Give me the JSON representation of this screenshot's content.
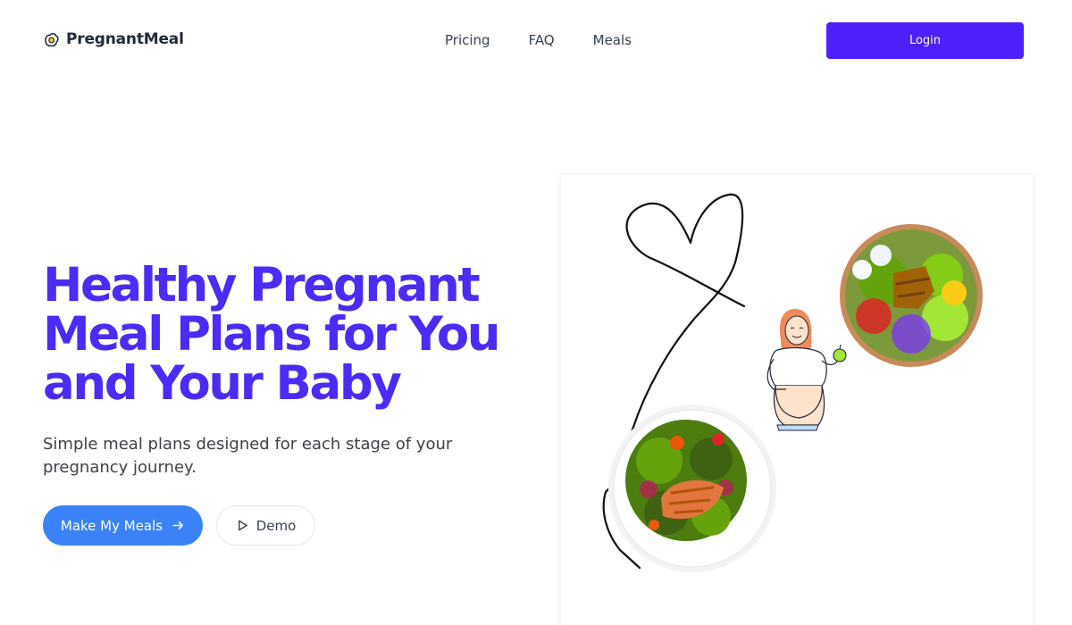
{
  "brand": {
    "name": "PregnantMeal",
    "icon": "egg-icon"
  },
  "nav": {
    "links": [
      {
        "label": "Pricing"
      },
      {
        "label": "FAQ"
      },
      {
        "label": "Meals"
      }
    ],
    "login_label": "Login"
  },
  "hero": {
    "title": "Healthy Pregnant Meal Plans for You and Your Baby",
    "subtitle": "Simple meal plans designed for each stage of your pregnancy journey.",
    "primary_cta": {
      "label": "Make My Meals",
      "icon": "arrow-right-icon"
    },
    "secondary_cta": {
      "label": "Demo",
      "icon": "play-icon"
    }
  },
  "colors": {
    "brand_primary": "#4f1ff9",
    "title": "#4b2bf5",
    "cta_primary": "#3b82f6"
  }
}
